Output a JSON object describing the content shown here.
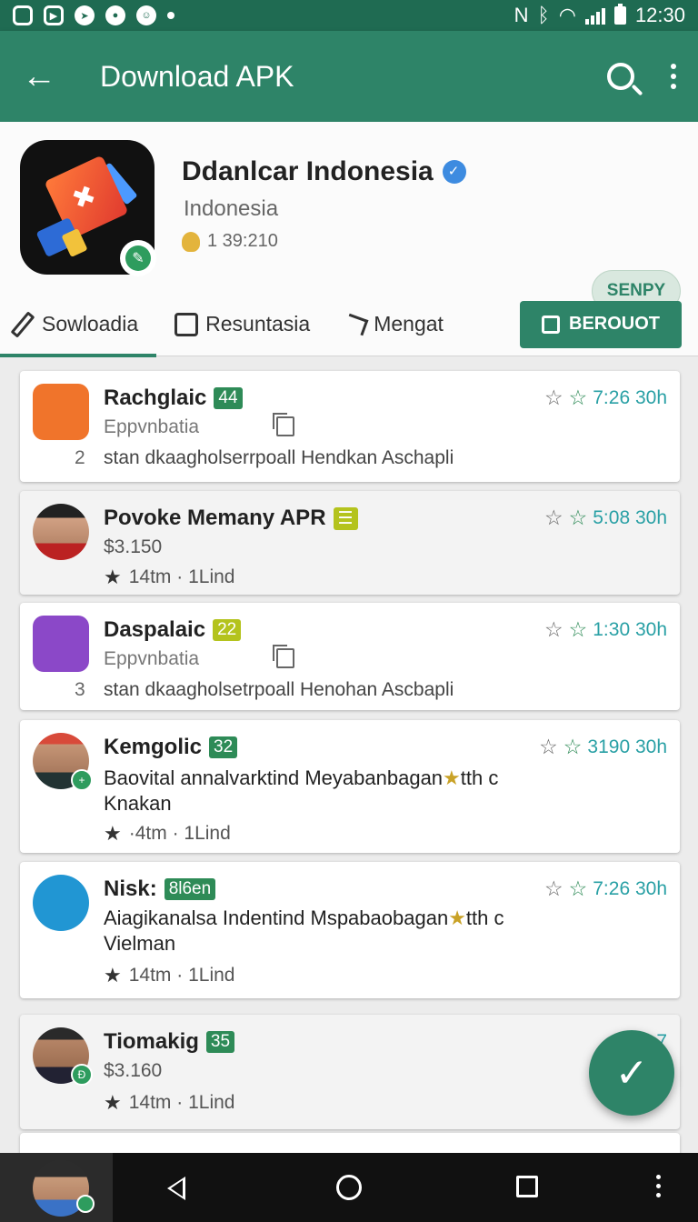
{
  "status_bar": {
    "time": "12:30"
  },
  "app_bar": {
    "title": "Download APK"
  },
  "header": {
    "app_name": "Ddanlcar Indonesia",
    "region": "Indonesia",
    "meta": "1 39:210",
    "pill_button": "SENPY"
  },
  "tabs": [
    {
      "label": "Sowloadia"
    },
    {
      "label": "Resuntasia"
    },
    {
      "label": "Mengat"
    }
  ],
  "primary_button": "BEROUOT",
  "items": [
    {
      "name": "Rachglaic",
      "badge": "44",
      "line2": "Eppvnbatia",
      "num": "2",
      "line3": "stan dkaagholserrpoall Hendkan Aschapli",
      "time": "7:26 30h"
    },
    {
      "name": "Povoke Memany APR",
      "badge": "",
      "line2": "$3.150",
      "stat": "14tm · 1Lind",
      "time": "5:08 30h"
    },
    {
      "name": "Daspalaic",
      "badge": "22",
      "line2": "Eppvnbatia",
      "num": "3",
      "line3": "stan dkaagholsetrpoall Henohan Ascbapli",
      "time": "1:30 30h"
    },
    {
      "name": "Kemgolic",
      "badge": "32",
      "desc": "Baovital annalvarktind Meyabanbagan",
      "desc_extra": "tth c",
      "desc2": "Knakan",
      "stat": "·4tm · 1Lind",
      "time": "3190 30h"
    },
    {
      "name": "Nisk:",
      "badge": "8l6en",
      "desc": "Aiagikanalsa Indentind Mspabaobagan",
      "desc_extra": "tth c",
      "desc2": "Vielman",
      "stat": "14tm · 1Lind",
      "time": "7:26 30h"
    },
    {
      "name": "Tiomakig",
      "badge": "35",
      "line2": "$3.160",
      "stat": "14tm · 1Lind",
      "time": "7"
    }
  ],
  "colors": {
    "primary": "#2e8468",
    "status": "#1f6b52",
    "accent": "#29a0a5"
  }
}
